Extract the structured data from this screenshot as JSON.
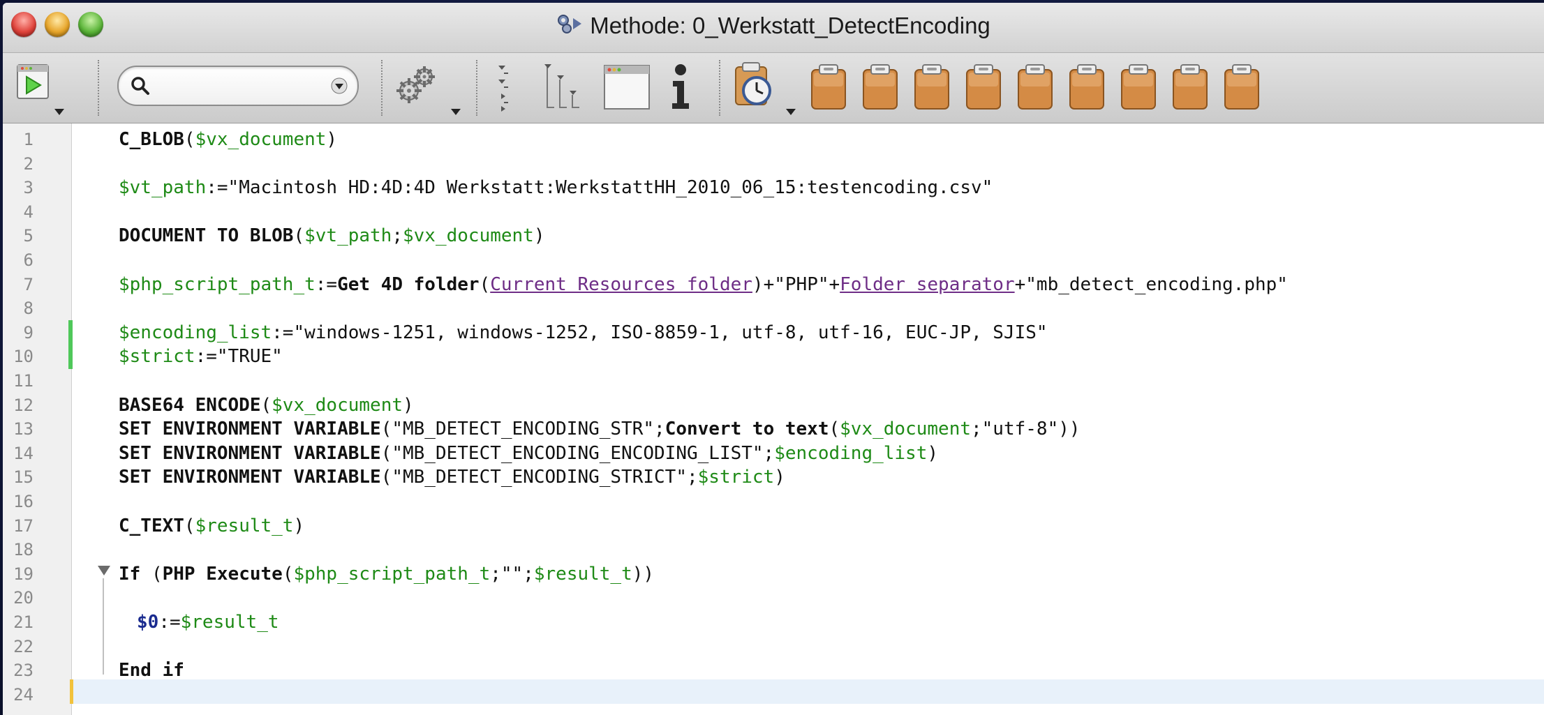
{
  "window": {
    "title": "Methode: 0_Werkstatt_DetectEncoding"
  },
  "toolbar": {
    "search": {
      "value": "",
      "placeholder": ""
    },
    "icons": [
      "run-method-icon",
      "search-icon",
      "gear-icon",
      "collapse-icon",
      "expand-icon",
      "window-icon",
      "info-icon",
      "clock-clipboard-icon",
      "clipboard-icon"
    ],
    "clipboard_count": 9
  },
  "editor": {
    "line_numbers": [
      "1",
      "2",
      "3",
      "4",
      "5",
      "6",
      "7",
      "8",
      "9",
      "10",
      "11",
      "12",
      "13",
      "14",
      "15",
      "16",
      "17",
      "18",
      "19",
      "20",
      "21",
      "22",
      "23",
      "24"
    ],
    "lines": {
      "l1": [
        {
          "t": "C_BLOB",
          "c": "kw"
        },
        {
          "t": "(",
          "c": "p"
        },
        {
          "t": "$vx_document",
          "c": "var"
        },
        {
          "t": ")",
          "c": "p"
        }
      ],
      "l3": [
        {
          "t": "$vt_path",
          "c": "var"
        },
        {
          "t": ":=\"Macintosh HD:4D:4D Werkstatt:WerkstattHH_2010_06_15:testencoding.csv\"",
          "c": "str"
        }
      ],
      "l5": [
        {
          "t": "DOCUMENT TO BLOB",
          "c": "kw"
        },
        {
          "t": "(",
          "c": "p"
        },
        {
          "t": "$vt_path",
          "c": "var"
        },
        {
          "t": ";",
          "c": "p"
        },
        {
          "t": "$vx_document",
          "c": "var"
        },
        {
          "t": ")",
          "c": "p"
        }
      ],
      "l7": [
        {
          "t": "$php_script_path_t",
          "c": "var"
        },
        {
          "t": ":=",
          "c": "p"
        },
        {
          "t": "Get 4D folder",
          "c": "kw"
        },
        {
          "t": "(",
          "c": "p"
        },
        {
          "t": "Current Resources folder",
          "c": "fn"
        },
        {
          "t": ")+\"PHP\"+",
          "c": "p"
        },
        {
          "t": "Folder separator",
          "c": "fn"
        },
        {
          "t": "+\"mb_detect_encoding.php\"",
          "c": "p"
        }
      ],
      "l9": [
        {
          "t": "$encoding_list",
          "c": "var"
        },
        {
          "t": ":=\"windows-1251, windows-1252, ISO-8859-1, utf-8, utf-16, EUC-JP, SJIS\"",
          "c": "str"
        }
      ],
      "l10": [
        {
          "t": "$strict",
          "c": "var"
        },
        {
          "t": ":=\"TRUE\"",
          "c": "str"
        }
      ],
      "l12": [
        {
          "t": "BASE64 ENCODE",
          "c": "kw"
        },
        {
          "t": "(",
          "c": "p"
        },
        {
          "t": "$vx_document",
          "c": "var"
        },
        {
          "t": ")",
          "c": "p"
        }
      ],
      "l13": [
        {
          "t": "SET ENVIRONMENT VARIABLE",
          "c": "kw"
        },
        {
          "t": "(\"MB_DETECT_ENCODING_STR\";",
          "c": "p"
        },
        {
          "t": "Convert to text",
          "c": "kw"
        },
        {
          "t": "(",
          "c": "p"
        },
        {
          "t": "$vx_document",
          "c": "var"
        },
        {
          "t": ";\"utf-8\"))",
          "c": "p"
        }
      ],
      "l14": [
        {
          "t": "SET ENVIRONMENT VARIABLE",
          "c": "kw"
        },
        {
          "t": "(\"MB_DETECT_ENCODING_ENCODING_LIST\";",
          "c": "p"
        },
        {
          "t": "$encoding_list",
          "c": "var"
        },
        {
          "t": ")",
          "c": "p"
        }
      ],
      "l15": [
        {
          "t": "SET ENVIRONMENT VARIABLE",
          "c": "kw"
        },
        {
          "t": "(\"MB_DETECT_ENCODING_STRICT\";",
          "c": "p"
        },
        {
          "t": "$strict",
          "c": "var"
        },
        {
          "t": ")",
          "c": "p"
        }
      ],
      "l17": [
        {
          "t": "C_TEXT",
          "c": "kw"
        },
        {
          "t": "(",
          "c": "p"
        },
        {
          "t": "$result_t",
          "c": "var"
        },
        {
          "t": ")",
          "c": "p"
        }
      ],
      "l19": [
        {
          "t": "If",
          "c": "kw"
        },
        {
          "t": " (",
          "c": "p"
        },
        {
          "t": "PHP Execute",
          "c": "kw"
        },
        {
          "t": "(",
          "c": "p"
        },
        {
          "t": "$php_script_path_t",
          "c": "var"
        },
        {
          "t": ";\"\";",
          "c": "p"
        },
        {
          "t": "$result_t",
          "c": "var"
        },
        {
          "t": "))",
          "c": "p"
        }
      ],
      "l21": [
        {
          "t": "$0",
          "c": "ret"
        },
        {
          "t": ":=",
          "c": "p"
        },
        {
          "t": "$result_t",
          "c": "var"
        }
      ],
      "l23": [
        {
          "t": "End if",
          "c": "kw"
        }
      ]
    }
  },
  "colors": {
    "variable": "#1e8a16",
    "command_link": "#6e2d86",
    "return_var": "#1a2b8f",
    "modified_marker": "#4fc85a",
    "current_line": "#e8f1fa"
  }
}
